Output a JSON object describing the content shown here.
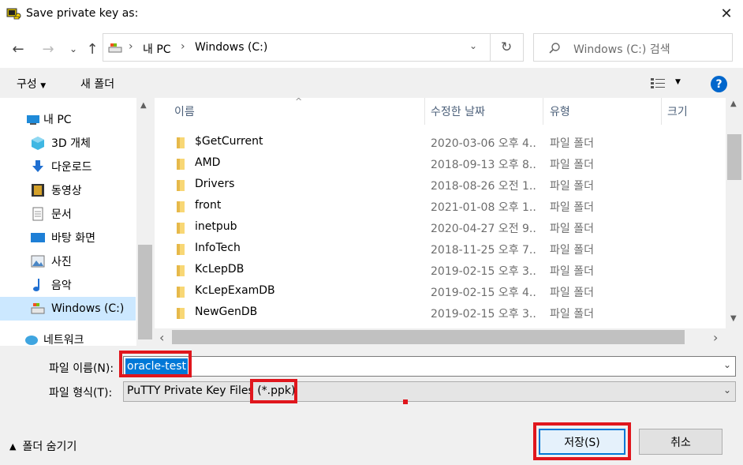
{
  "window": {
    "title": "Save private key as:"
  },
  "nav": {
    "breadcrumb": [
      "내 PC",
      "Windows (C:)"
    ],
    "search_placeholder": "Windows (C:) 검색"
  },
  "toolbar": {
    "organize_label": "구성",
    "new_folder_label": "새 폴더"
  },
  "sidebar": {
    "items": [
      {
        "label": "내 PC",
        "icon": "pc-icon"
      },
      {
        "label": "3D 개체",
        "icon": "cube-icon"
      },
      {
        "label": "다운로드",
        "icon": "download-icon"
      },
      {
        "label": "동영상",
        "icon": "video-icon"
      },
      {
        "label": "문서",
        "icon": "document-icon"
      },
      {
        "label": "바탕 화면",
        "icon": "desktop-icon"
      },
      {
        "label": "사진",
        "icon": "picture-icon"
      },
      {
        "label": "음악",
        "icon": "music-icon"
      },
      {
        "label": "Windows (C:)",
        "icon": "drive-icon",
        "selected": true
      },
      {
        "label": "네트워크",
        "icon": "network-icon"
      }
    ]
  },
  "filelist": {
    "columns": [
      "이름",
      "수정한 날짜",
      "유형",
      "크기"
    ],
    "rows": [
      {
        "name": "$GetCurrent",
        "date": "2020-03-06 오후 4...",
        "type": "파일 폴더"
      },
      {
        "name": "AMD",
        "date": "2018-09-13 오후 8...",
        "type": "파일 폴더"
      },
      {
        "name": "Drivers",
        "date": "2018-08-26 오전 1...",
        "type": "파일 폴더"
      },
      {
        "name": "front",
        "date": "2021-01-08 오후 1...",
        "type": "파일 폴더"
      },
      {
        "name": "inetpub",
        "date": "2020-04-27 오전 9...",
        "type": "파일 폴더"
      },
      {
        "name": "InfoTech",
        "date": "2018-11-25 오후 7...",
        "type": "파일 폴더"
      },
      {
        "name": "KcLepDB",
        "date": "2019-02-15 오후 3...",
        "type": "파일 폴더"
      },
      {
        "name": "KcLepExamDB",
        "date": "2019-02-15 오후 4...",
        "type": "파일 폴더"
      },
      {
        "name": "NewGenDB",
        "date": "2019-02-15 오후 3...",
        "type": "파일 폴더"
      }
    ]
  },
  "form": {
    "filename_label": "파일 이름(N):",
    "filename_value": "oracle-test",
    "filetype_label": "파일 형식(T):",
    "filetype_value": "PuTTY Private Key Files (*.ppk)"
  },
  "footer": {
    "hide_folders_label": "폴더 숨기기",
    "save_label": "저장(S)",
    "cancel_label": "취소"
  },
  "colors": {
    "accent": "#0078d7",
    "highlight": "#e0161d",
    "selected_bg": "#cce8ff",
    "folder": "#f8d775"
  }
}
